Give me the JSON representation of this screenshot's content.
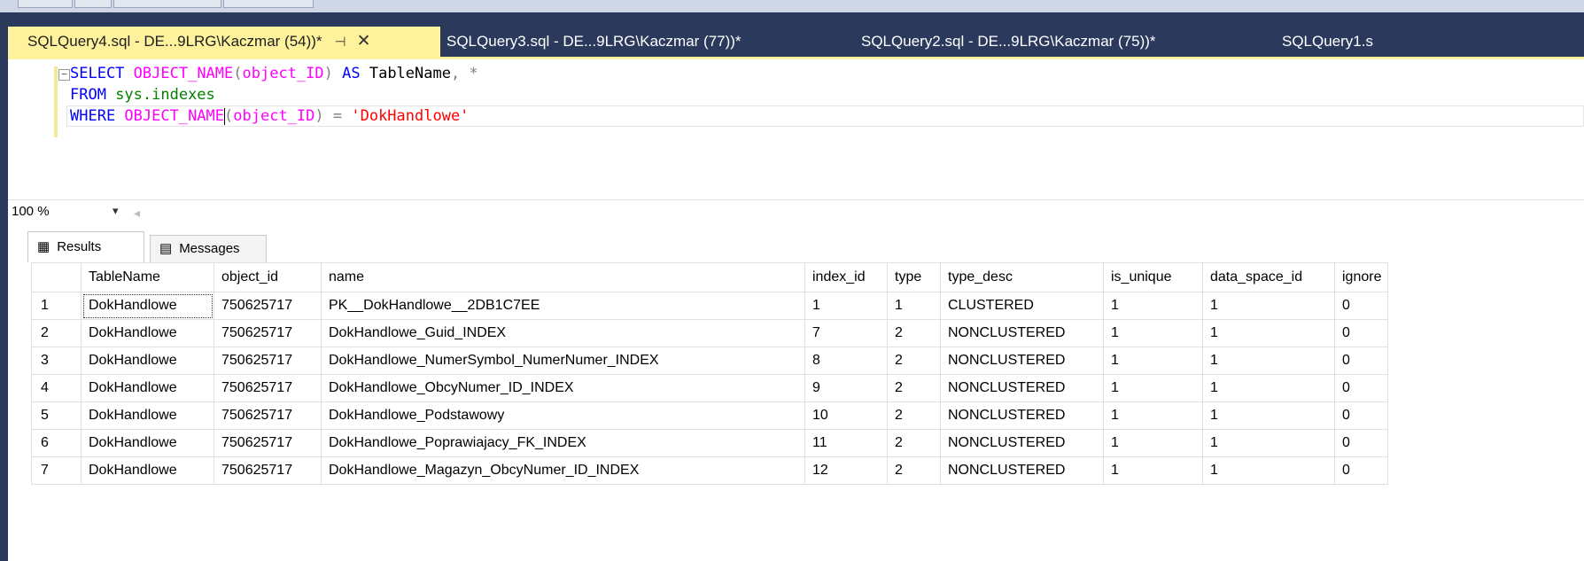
{
  "tabs": [
    {
      "label": "SQLQuery4.sql - DE...9LRG\\Kaczmar (54))*",
      "active": true
    },
    {
      "label": "SQLQuery3.sql - DE...9LRG\\Kaczmar (77))*",
      "active": false
    },
    {
      "label": "SQLQuery2.sql - DE...9LRG\\Kaczmar (75))*",
      "active": false
    },
    {
      "label": "SQLQuery1.s",
      "active": false
    }
  ],
  "tab_icons": {
    "pin": "pin-icon",
    "close": "close-icon"
  },
  "editor": {
    "line1": {
      "kw1": "SELECT",
      "fn1": "OBJECT_NAME",
      "p1": "(",
      "id1": "object_ID",
      "p2": ")",
      "kw2": " AS ",
      "plain1": "TableName",
      "gray1": ", *"
    },
    "line2": {
      "kw1": "FROM ",
      "sys1": "sys.indexes"
    },
    "line3": {
      "kw1": "WHERE ",
      "fn1": "OBJECT_NAME",
      "p1": "(",
      "id1": "object_ID",
      "p2": ")",
      "gray1": " = ",
      "str1": "'DokHandlowe'"
    }
  },
  "status": {
    "zoom": "100 %"
  },
  "results_tabs": {
    "results": "Results",
    "messages": "Messages"
  },
  "grid": {
    "columns": [
      "",
      "TableName",
      "object_id",
      "name",
      "index_id",
      "type",
      "type_desc",
      "is_unique",
      "data_space_id",
      "ignore"
    ],
    "rows": [
      [
        "1",
        "DokHandlowe",
        "750625717",
        "PK__DokHandlowe__2DB1C7EE",
        "1",
        "1",
        "CLUSTERED",
        "1",
        "1",
        "0"
      ],
      [
        "2",
        "DokHandlowe",
        "750625717",
        "DokHandlowe_Guid_INDEX",
        "7",
        "2",
        "NONCLUSTERED",
        "1",
        "1",
        "0"
      ],
      [
        "3",
        "DokHandlowe",
        "750625717",
        "DokHandlowe_NumerSymbol_NumerNumer_INDEX",
        "8",
        "2",
        "NONCLUSTERED",
        "1",
        "1",
        "0"
      ],
      [
        "4",
        "DokHandlowe",
        "750625717",
        "DokHandlowe_ObcyNumer_ID_INDEX",
        "9",
        "2",
        "NONCLUSTERED",
        "1",
        "1",
        "0"
      ],
      [
        "5",
        "DokHandlowe",
        "750625717",
        "DokHandlowe_Podstawowy",
        "10",
        "2",
        "NONCLUSTERED",
        "1",
        "1",
        "0"
      ],
      [
        "6",
        "DokHandlowe",
        "750625717",
        "DokHandlowe_Poprawiajacy_FK_INDEX",
        "11",
        "2",
        "NONCLUSTERED",
        "1",
        "1",
        "0"
      ],
      [
        "7",
        "DokHandlowe",
        "750625717",
        "DokHandlowe_Magazyn_ObcyNumer_ID_INDEX",
        "12",
        "2",
        "NONCLUSTERED",
        "1",
        "1",
        "0"
      ]
    ]
  },
  "colors": {
    "active_tab": "#fff29d",
    "chrome": "#2b3a5c",
    "keyword": "#0000ff",
    "function": "#ff00ff",
    "string": "#ff0000",
    "system": "#008000"
  }
}
